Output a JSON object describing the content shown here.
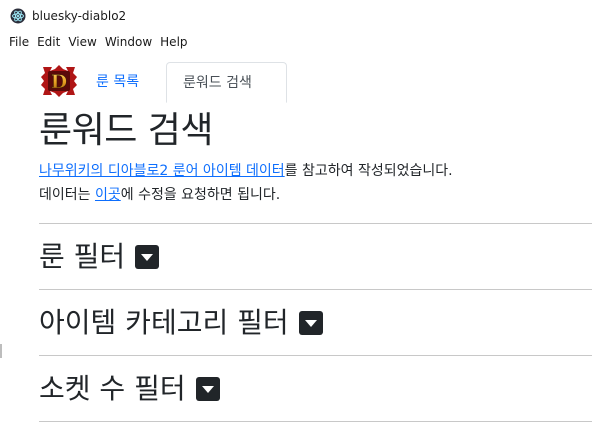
{
  "window": {
    "title": "bluesky-diablo2"
  },
  "menu": [
    {
      "label": "File"
    },
    {
      "label": "Edit"
    },
    {
      "label": "View"
    },
    {
      "label": "Window"
    },
    {
      "label": "Help"
    }
  ],
  "nav": {
    "logo_text": "D",
    "tabs": [
      {
        "label": "룬 목록",
        "active": false
      },
      {
        "label": "룬워드 검색",
        "active": true
      }
    ]
  },
  "page": {
    "title": "룬워드 검색",
    "desc_line1_link": "나무위키의 디아블로2 룬어 아이템 데이터",
    "desc_line1_rest": "를 참고하여 작성되었습니다.",
    "desc_line2_before": "데이터는 ",
    "desc_line2_link": "이곳",
    "desc_line2_after": "에 수정을 요청하면 됩니다."
  },
  "filters": [
    {
      "label": "룬 필터",
      "icon": "caret-down-square-icon"
    },
    {
      "label": "아이템 카테고리 필터",
      "icon": "caret-down-square-icon"
    },
    {
      "label": "소켓 수 필터",
      "icon": "caret-down-square-icon"
    }
  ],
  "colors": {
    "link": "#0d6efd",
    "text": "#212529",
    "logo_gold": "#e8a020",
    "logo_red": "#b01515"
  }
}
